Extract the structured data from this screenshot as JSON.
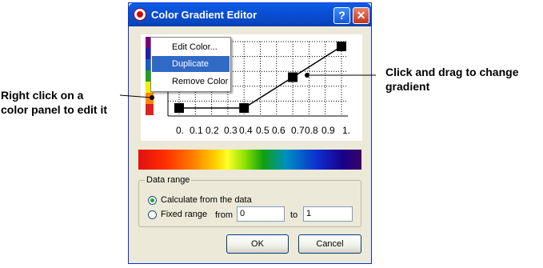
{
  "annotations": {
    "left": "Right click on a\ncolor panel to edit it",
    "right": "Click and drag to change\ngradient"
  },
  "window": {
    "title": "Color Gradient Editor",
    "help_glyph": "?",
    "close_glyph": "✕"
  },
  "color_panels": [
    "#7a007a",
    "#2020b0",
    "#1060c0",
    "#20a020",
    "#f0f000",
    "#ff8800",
    "#e02020"
  ],
  "chart_data": {
    "type": "line",
    "x_ticks": [
      "0.",
      "0.1",
      "0.2",
      "0.3",
      "0.4",
      "0.5",
      "0.6",
      "0.7",
      "0.8",
      "0.9",
      "1."
    ],
    "x": [
      0.0,
      0.1,
      0.35,
      0.47,
      0.6,
      0.7,
      0.83,
      0.96
    ],
    "xlim": [
      0,
      1
    ],
    "ylim": [
      0,
      1
    ],
    "grid": true,
    "control_points": [
      {
        "x": 0.0,
        "y": 0.0
      },
      {
        "x": 0.4,
        "y": 0.0
      },
      {
        "x": 0.7,
        "y": 0.5
      },
      {
        "x": 1.0,
        "y": 1.0
      }
    ]
  },
  "context_menu": {
    "items": [
      "Edit Color...",
      "Duplicate Color",
      "Remove Color"
    ],
    "highlighted": 1
  },
  "gradient_colors": [
    "#e21010",
    "#ff7a00",
    "#ffff2a",
    "#10a010",
    "#0d2fd0",
    "#3a0068"
  ],
  "data_range": {
    "label": "Data range",
    "option_calculate": "Calculate from the data",
    "option_fixed": "Fixed range",
    "from_label": "from",
    "from_value": "0",
    "to_label": "to",
    "to_value": "1"
  },
  "buttons": {
    "ok": "OK",
    "cancel": "Cancel"
  }
}
